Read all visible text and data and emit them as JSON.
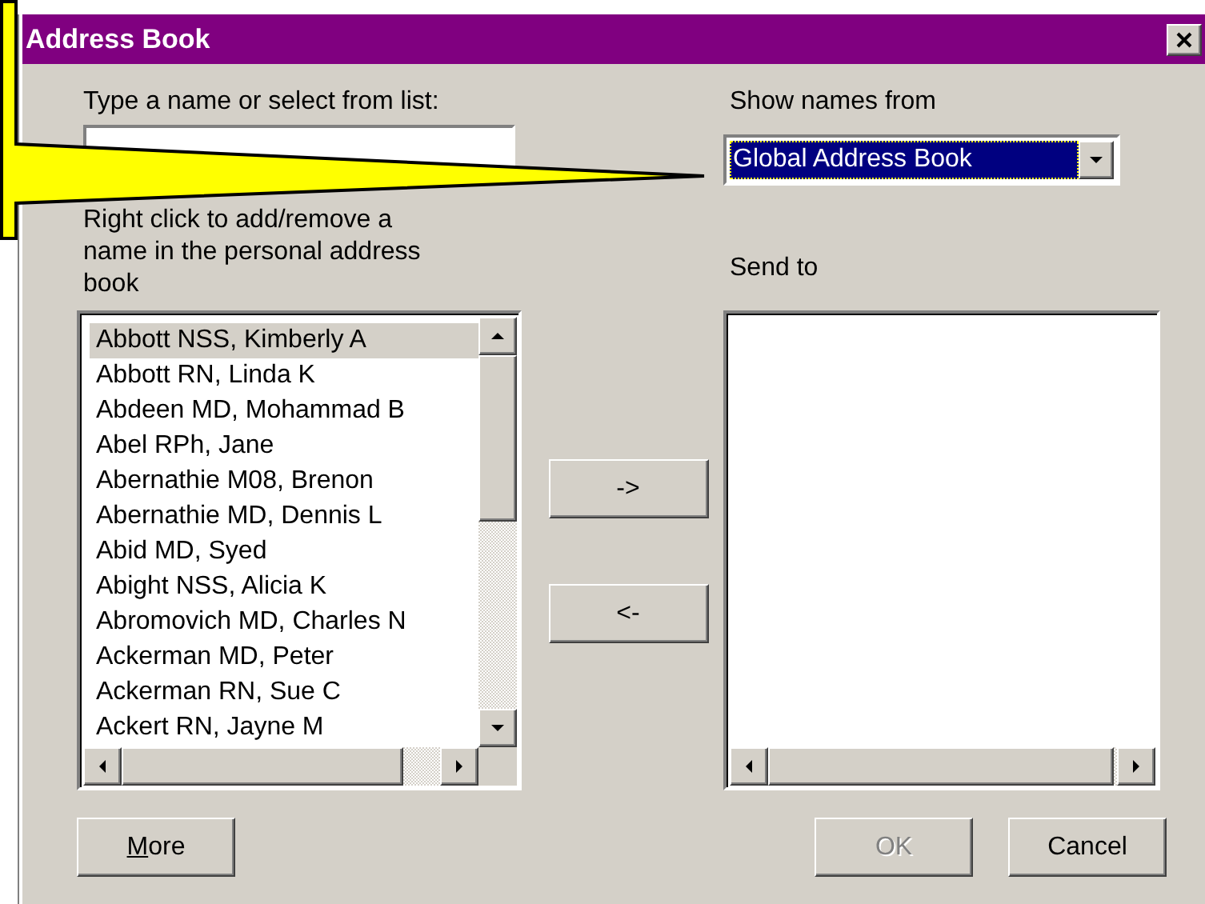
{
  "window": {
    "title": "Address Book"
  },
  "name_field": {
    "label": "Type a name or select from list:"
  },
  "source": {
    "label": "Show names from",
    "value": "Global Address Book"
  },
  "names_list": {
    "label": "Right click to add/remove a name in the personal address book",
    "items": [
      {
        "text": "Abbott NSS, Kimberly A",
        "selected": true
      },
      {
        "text": "Abbott RN, Linda K",
        "selected": false
      },
      {
        "text": "Abdeen MD, Mohammad B",
        "selected": false
      },
      {
        "text": "Abel RPh, Jane",
        "selected": false
      },
      {
        "text": "Abernathie M08, Brenon",
        "selected": false
      },
      {
        "text": "Abernathie MD, Dennis L",
        "selected": false
      },
      {
        "text": "Abid MD, Syed",
        "selected": false
      },
      {
        "text": "Abight NSS, Alicia K",
        "selected": false
      },
      {
        "text": "Abromovich MD, Charles N",
        "selected": false
      },
      {
        "text": "Ackerman MD, Peter",
        "selected": false
      },
      {
        "text": "Ackerman RN, Sue C",
        "selected": false
      },
      {
        "text": "Ackert RN, Jayne M",
        "selected": false
      }
    ]
  },
  "move_buttons": [
    {
      "label": "->"
    },
    {
      "label": "<-"
    }
  ],
  "send_to": {
    "label": "Send to"
  },
  "buttons": [
    {
      "label": "More",
      "mnemonic": true,
      "disabled": false
    },
    {
      "label": "OK",
      "disabled": true
    },
    {
      "label": "Cancel",
      "disabled": false
    }
  ]
}
